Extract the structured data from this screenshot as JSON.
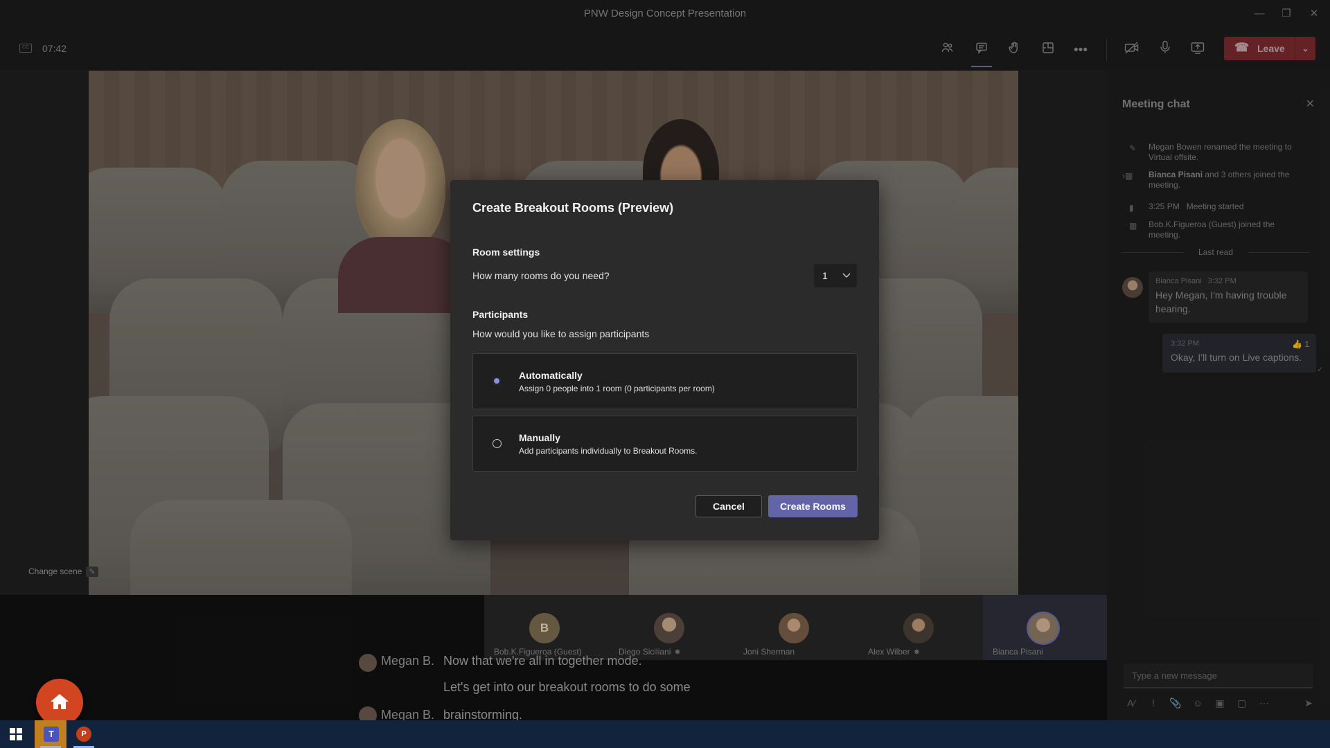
{
  "window": {
    "title": "PNW Design Concept Presentation"
  },
  "toolbar": {
    "timer": "07:42",
    "leave_label": "Leave",
    "icons": [
      "people-icon",
      "chat-icon",
      "raise-hand-icon",
      "rooms-icon",
      "more-icon",
      "camera-off-icon",
      "mic-icon",
      "share-icon"
    ]
  },
  "stage": {
    "change_scene_label": "Change scene"
  },
  "participants": [
    {
      "name": "Bob.K.Figueroa (Guest)",
      "initial": "B"
    },
    {
      "name": "Diego Siciliani",
      "muted": true
    },
    {
      "name": "Joni Sherman"
    },
    {
      "name": "Alex Wilber",
      "muted": true
    },
    {
      "name": "Bianca Pisani",
      "speaking": true
    }
  ],
  "captions": [
    {
      "speaker": "Megan B.",
      "text": "Now that we're all in together mode."
    },
    {
      "speaker": "",
      "text": "Let's get into our breakout rooms to do some"
    },
    {
      "speaker": "Megan B.",
      "text": "brainstorming."
    }
  ],
  "dialog": {
    "title": "Create Breakout Rooms (Preview)",
    "room_settings_heading": "Room settings",
    "rooms_question": "How many rooms do you need?",
    "rooms_value": "1",
    "participants_heading": "Participants",
    "assign_question": "How would you like to assign participants",
    "options": [
      {
        "title": "Automatically",
        "desc": "Assign 0 people into 1 room (0 participants per room)",
        "selected": true
      },
      {
        "title": "Manually",
        "desc": "Add participants individually to Breakout Rooms.",
        "selected": false
      }
    ],
    "cancel_label": "Cancel",
    "create_label": "Create Rooms",
    "accent_color": "#6264a7"
  },
  "chat": {
    "title": "Meeting chat",
    "events": [
      {
        "text_a": "Megan Bowen renamed the meeting to Virtual offsite."
      },
      {
        "bold": "Bianca Pisani",
        "text_a": " and 3 others joined the meeting."
      },
      {
        "time": "3:25 PM",
        "text_a": "Meeting started"
      },
      {
        "text_a": "Bob.K.Figueroa (Guest) joined the meeting."
      }
    ],
    "last_read": "Last read",
    "incoming": {
      "author": "Bianca Pisani",
      "time": "3:32 PM",
      "text": "Hey Megan, I'm having trouble hearing."
    },
    "outgoing": {
      "time": "3:32 PM",
      "text": "Okay, I'll turn on Live captions.",
      "reaction_count": "1"
    },
    "input_placeholder": "Type a new message"
  }
}
